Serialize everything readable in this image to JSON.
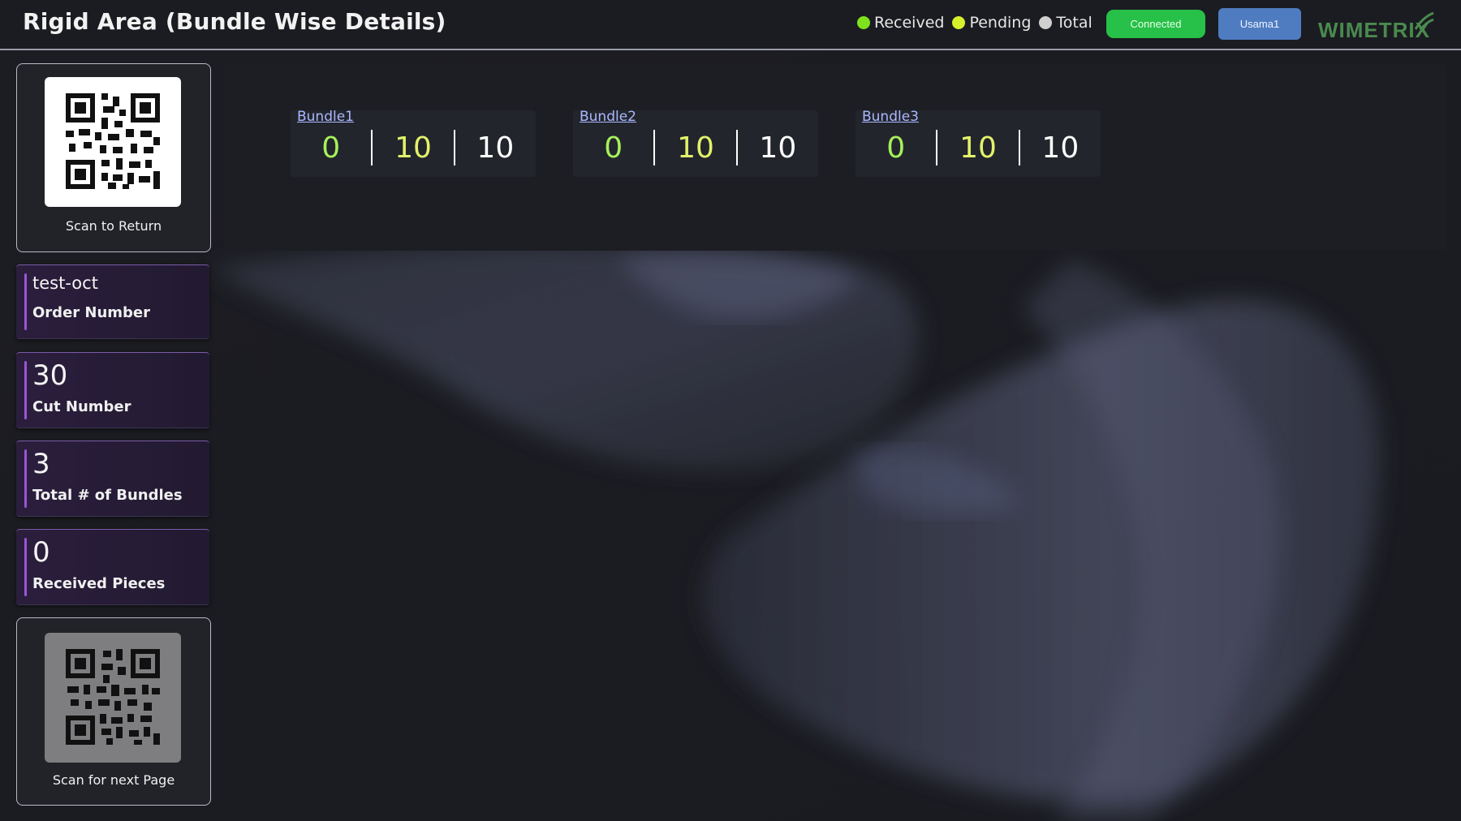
{
  "header": {
    "title": "Rigid Area (Bundle Wise Details)",
    "legend": [
      {
        "label": "Received",
        "color": "#7ee21d"
      },
      {
        "label": "Pending",
        "color": "#d8ef2c"
      },
      {
        "label": "Total",
        "color": "#d0d0d0"
      }
    ],
    "status_label": "Connected",
    "user_label": "Usama1",
    "logo_text": "WIMETRIX"
  },
  "sidebar": {
    "return_qr_label": "Scan to Return",
    "order": {
      "value": "test-oct",
      "label": "Order Number"
    },
    "cut": {
      "value": "30",
      "label": "Cut Number"
    },
    "bundles_total": {
      "value": "3",
      "label": "Total # of Bundles"
    },
    "received_pieces": {
      "value": "0",
      "label": "Received Pieces"
    },
    "next_qr_label": "Scan for next Page"
  },
  "bundles": [
    {
      "name": "Bundle1",
      "received": "0",
      "pending": "10",
      "total": "10"
    },
    {
      "name": "Bundle2",
      "received": "0",
      "pending": "10",
      "total": "10"
    },
    {
      "name": "Bundle3",
      "received": "0",
      "pending": "10",
      "total": "10"
    }
  ],
  "colors": {
    "received": "#a6f05a",
    "pending": "#e2f26a",
    "total": "#ffffff",
    "accent": "#9b54d6",
    "connected": "#27c048",
    "user": "#4f7cc0"
  }
}
